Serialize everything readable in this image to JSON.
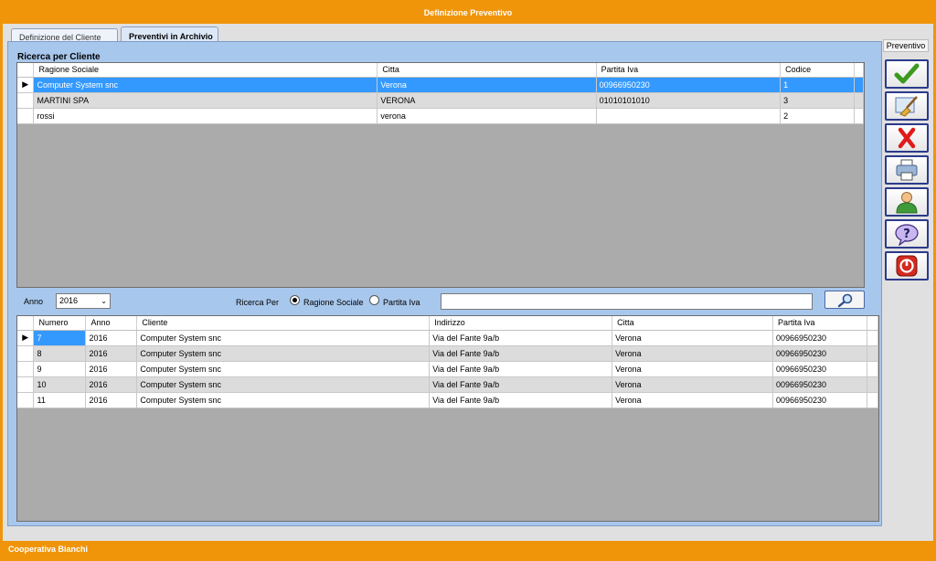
{
  "window": {
    "title": "Definizione Preventivo"
  },
  "tabs": [
    {
      "label": "Definizione del Cliente"
    },
    {
      "label": "Preventivi in Archivio"
    }
  ],
  "clienti": {
    "title": "Ricerca per  Cliente",
    "columns": [
      "Ragione Sociale",
      "Citta",
      "Partita Iva",
      "Codice"
    ],
    "rows": [
      {
        "ragione": "Computer System snc",
        "citta": "Verona",
        "piva": "00966950230",
        "codice": "1"
      },
      {
        "ragione": "MARTINI SPA",
        "citta": "VERONA",
        "piva": "01010101010",
        "codice": "3"
      },
      {
        "ragione": "rossi",
        "citta": "verona",
        "piva": "",
        "codice": "2"
      }
    ]
  },
  "filter": {
    "anno_label": "Anno",
    "anno_value": "2016",
    "ricerca_label": "Ricerca Per",
    "option_ragione": "Ragione Sociale",
    "option_piva": "Partita Iva",
    "search_value": ""
  },
  "preventivi": {
    "columns": [
      "Numero",
      "Anno",
      "Cliente",
      "Indirizzo",
      "Citta",
      "Partita Iva"
    ],
    "rows": [
      {
        "numero": "7",
        "anno": "2016",
        "cliente": "Computer System snc",
        "indirizzo": "Via del Fante 9a/b",
        "citta": "Verona",
        "piva": "00966950230"
      },
      {
        "numero": "8",
        "anno": "2016",
        "cliente": "Computer System snc",
        "indirizzo": "Via del Fante 9a/b",
        "citta": "Verona",
        "piva": "00966950230"
      },
      {
        "numero": "9",
        "anno": "2016",
        "cliente": "Computer System snc",
        "indirizzo": "Via del Fante 9a/b",
        "citta": "Verona",
        "piva": "00966950230"
      },
      {
        "numero": "10",
        "anno": "2016",
        "cliente": "Computer System snc",
        "indirizzo": "Via del Fante 9a/b",
        "citta": "Verona",
        "piva": "00966950230"
      },
      {
        "numero": "11",
        "anno": "2016",
        "cliente": "Computer System snc",
        "indirizzo": "Via del Fante 9a/b",
        "citta": "Verona",
        "piva": "00966950230"
      }
    ]
  },
  "toolbar": {
    "label": "Preventivo",
    "buttons": [
      "checkmark-icon",
      "broom-icon",
      "red-x-icon",
      "printer-icon",
      "user-icon",
      "help-icon",
      "power-icon"
    ]
  },
  "status": {
    "text": "Cooperativa Bianchi"
  },
  "colors": {
    "accent": "#f0940a",
    "panel": "#a8c7ec",
    "selection": "#3399ff",
    "toolbar_border": "#2b3a8c"
  }
}
